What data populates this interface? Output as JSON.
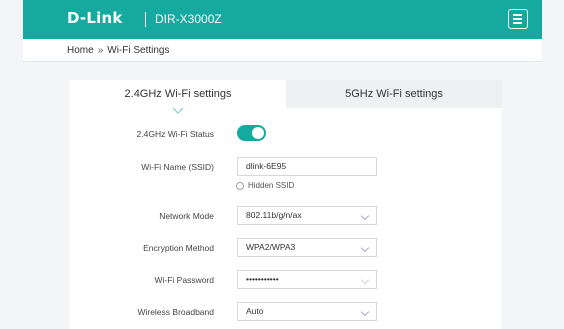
{
  "header": {
    "brand": "D-Link",
    "model": "DIR-X3000Z",
    "menu_icon": "menu-icon"
  },
  "breadcrumb": {
    "home": "Home",
    "separator": "»",
    "current": "Wi-Fi Settings"
  },
  "tabs": [
    {
      "label": "2.4GHz Wi-Fi settings",
      "active": true
    },
    {
      "label": "5GHz Wi-Fi settings",
      "active": false
    }
  ],
  "form": {
    "status": {
      "label": "2.4GHz Wi-Fi Status",
      "enabled": true
    },
    "ssid": {
      "label": "Wi-Fi Name (SSID)",
      "value": "dlink-6E95"
    },
    "hidden_ssid": {
      "label": "Hidden SSID",
      "checked": false
    },
    "network_mode": {
      "label": "Network Mode",
      "value": "802.11b/g/n/ax"
    },
    "encryption": {
      "label": "Encryption Method",
      "value": "WPA2/WPA3"
    },
    "password": {
      "label": "Wi-Fi Password",
      "value": "•••••••••••"
    },
    "bandwidth": {
      "label": "Wireless Broadband",
      "value": "Auto"
    }
  },
  "colors": {
    "accent": "#16a9a0",
    "background": "#f4f5f7",
    "inactive_tab": "#eef0f2"
  }
}
